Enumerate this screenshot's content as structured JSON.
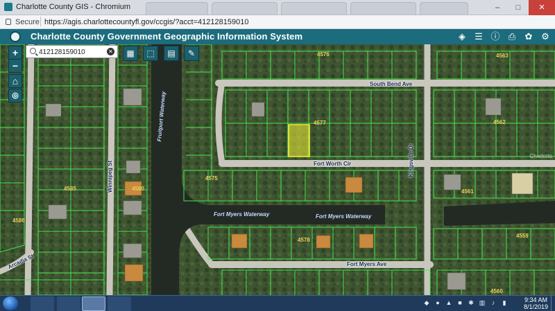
{
  "browser": {
    "window_title": "Charlotte County GIS - Chromium",
    "secure_label": "Secure",
    "url": "https://agis.charlottecountyfl.gov/ccgis/?acct=412128159010",
    "min_label": "–",
    "max_label": "□",
    "close_label": "✕"
  },
  "app": {
    "title": "Charlotte County Government Geographic Information System",
    "tools": [
      "layers-icon",
      "list-icon",
      "info-icon",
      "print-icon",
      "palette-icon",
      "settings-icon"
    ]
  },
  "search": {
    "value": "412128159010",
    "placeholder": ""
  },
  "map_controls": {
    "zoom_in": "+",
    "zoom_out": "−"
  },
  "map": {
    "road_labels": [
      "South Bend Ave",
      "Fort Worth Cir",
      "Fort Myers Ave",
      "Kingsville Dr",
      "Winnipeg St",
      "Arcadia St"
    ],
    "waterway_labels": [
      "Fruitport Waterway",
      "Fort Myers Waterway",
      "Fort Myers Waterway"
    ],
    "block_labels": [
      "4576",
      "4563",
      "4577",
      "4562",
      "4575",
      "4561",
      "4585",
      "4580",
      "4586",
      "4578",
      "4559",
      "4560"
    ],
    "attribution": "Charlotte",
    "selected_parcel_color": "#f2f234",
    "parcel_line_color": "#46e84e"
  },
  "taskbar": {
    "time": "9:34 AM",
    "date": "8/1/2019"
  },
  "colors": {
    "app_header": "#1c6c7d",
    "taskbar": "#1f3a5b"
  }
}
